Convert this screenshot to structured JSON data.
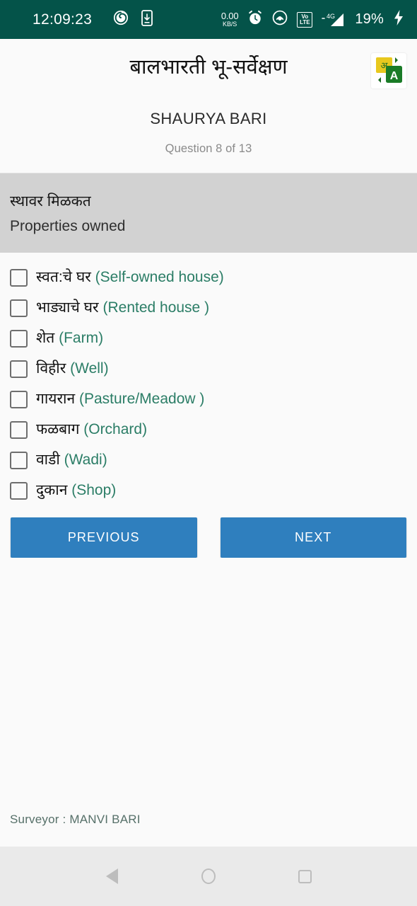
{
  "status_bar": {
    "clock": "12:09:23",
    "data_rate_value": "0.00",
    "data_rate_unit": "KB/S",
    "battery": "19%",
    "volte_top": "Vo",
    "volte_bottom": "LTE",
    "network_label": "4G",
    "icons": [
      "spiral-icon",
      "phone-download-icon",
      "data-rate-icon",
      "alarm-clock-icon",
      "hotspot-icon",
      "volte-icon",
      "signal-4g-icon",
      "battery-percent-label",
      "charging-bolt-icon"
    ],
    "background_color": "#045349"
  },
  "header": {
    "title": "बालभारती भू-सर्वेक्षण",
    "subtitle": "SHAURYA BARI",
    "question_counter": "Question 8 of 13",
    "translate_badge": {
      "source_glyph": "अ",
      "target_glyph": "A",
      "source_color": "#e8c81e",
      "target_color": "#1a7b27"
    }
  },
  "question": {
    "text_marathi": "स्थावर मिळकत",
    "text_english": "Properties owned",
    "band_color": "#d2d2d2"
  },
  "options": [
    {
      "marathi": "स्वत:चे घर",
      "english": "(Self-owned house)",
      "checked": false
    },
    {
      "marathi": "भाड्याचे घर",
      "english": "(Rented house )",
      "checked": false
    },
    {
      "marathi": "शेत",
      "english": "(Farm)",
      "checked": false
    },
    {
      "marathi": "विहीर",
      "english": "(Well)",
      "checked": false
    },
    {
      "marathi": "गायरान",
      "english": "(Pasture/Meadow )",
      "checked": false
    },
    {
      "marathi": "फळबाग",
      "english": "(Orchard)",
      "checked": false
    },
    {
      "marathi": "वाडी",
      "english": "(Wadi)",
      "checked": false
    },
    {
      "marathi": "दुकान",
      "english": "(Shop)",
      "checked": false
    }
  ],
  "buttons": {
    "previous_label": "PREVIOUS",
    "next_label": "NEXT",
    "accent_color": "#2f7fbe"
  },
  "footer": {
    "surveyor_text": "Surveyor : MANVI BARI"
  },
  "android_nav": {
    "back_label": "Back",
    "home_label": "Home",
    "recents_label": "Recents"
  },
  "colors": {
    "status_bar": "#045349",
    "page_background": "#fafafa",
    "question_band": "#d2d2d2",
    "english_text": "#2b7d66",
    "button_blue": "#2f7fbe",
    "footer_text": "#567069"
  }
}
